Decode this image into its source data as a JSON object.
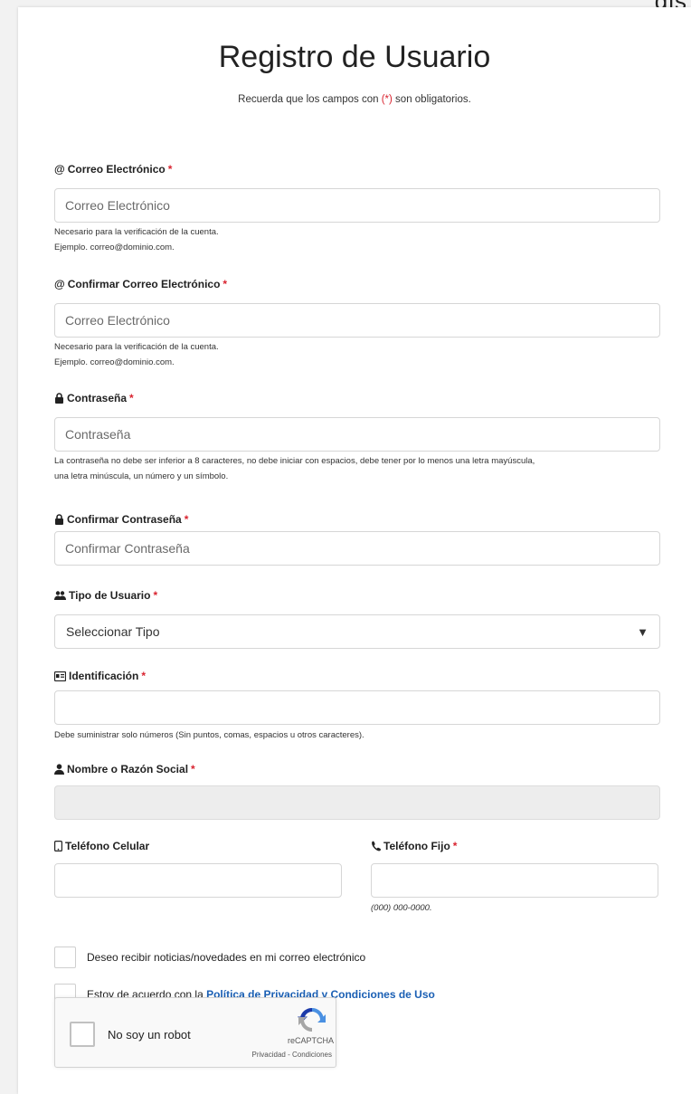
{
  "top_fragment": "gis",
  "form": {
    "title": "Registro de Usuario",
    "subtitle_pre": "Recuerda que los campos con ",
    "subtitle_mark": "(*)",
    "subtitle_post": " son obligatorios.",
    "required_mark": "*"
  },
  "email": {
    "icon": "@",
    "label": "Correo Electrónico",
    "placeholder": "Correo Electrónico",
    "help1": "Necesario para la verificación de la cuenta.",
    "help2": "Ejemplo. correo@dominio.com."
  },
  "email_confirm": {
    "icon": "@",
    "label": "Confirmar Correo Electrónico",
    "placeholder": "Correo Electrónico",
    "help1": "Necesario para la verificación de la cuenta.",
    "help2": "Ejemplo. correo@dominio.com."
  },
  "password": {
    "label": "Contraseña",
    "placeholder": "Contraseña",
    "help1": "La contraseña no debe ser inferior a 8 caracteres, no debe iniciar con espacios, debe tener por lo menos una letra mayúscula,",
    "help2": "una letra minúscula, un número y un símbolo."
  },
  "password_confirm": {
    "label": "Confirmar Contraseña",
    "placeholder": "Confirmar Contraseña"
  },
  "user_type": {
    "label": "Tipo de Usuario",
    "selected": "Seleccionar Tipo"
  },
  "identification": {
    "label": "Identificación",
    "value": "",
    "help": "Debe suministrar solo números (Sin puntos, comas, espacios u otros caracteres)."
  },
  "name": {
    "label": "Nombre o Razón Social",
    "value": ""
  },
  "cell_phone": {
    "label": "Teléfono Celular",
    "value": ""
  },
  "land_phone": {
    "label": "Teléfono Fijo",
    "value": "",
    "help": "(000) 000-0000."
  },
  "news_checkbox": {
    "label": "Deseo recibir noticias/novedades en mi correo electrónico",
    "checked": false
  },
  "terms_checkbox": {
    "label_pre": "Estoy de acuerdo con la ",
    "link": "Política de Privacidad y Condiciones de Uso",
    "checked": false
  },
  "captcha": {
    "label": "No soy un robot",
    "brand": "reCAPTCHA",
    "terms": "Privacidad - Condiciones"
  },
  "colors": {
    "required": "#d9232f",
    "link": "#1a5fb4",
    "disabled_bg": "#ededed"
  }
}
